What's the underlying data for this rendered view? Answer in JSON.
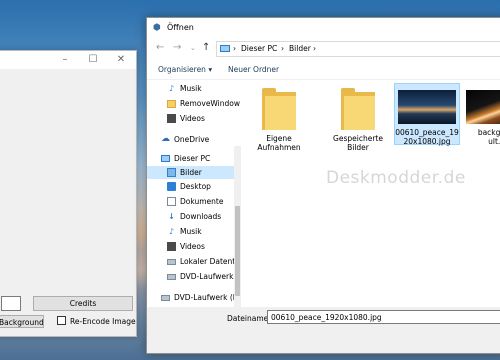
{
  "dialog": {
    "title": "Öffnen",
    "breadcrumb": [
      "Dieser PC",
      "Bilder"
    ],
    "toolbar": {
      "organize": "Organisieren ▾",
      "new_folder": "Neuer Ordner"
    },
    "nav_items": [
      {
        "label": "Musik",
        "icon": "music-icon"
      },
      {
        "label": "RemoveWindow",
        "icon": "folder-icon"
      },
      {
        "label": "Videos",
        "icon": "video-icon"
      },
      {
        "label": "OneDrive",
        "icon": "cloud-icon"
      },
      {
        "label": "Dieser PC",
        "icon": "pc-icon"
      },
      {
        "label": "Bilder",
        "icon": "pictures-icon"
      },
      {
        "label": "Desktop",
        "icon": "desktop-icon"
      },
      {
        "label": "Dokumente",
        "icon": "documents-icon"
      },
      {
        "label": "Downloads",
        "icon": "downloads-icon"
      },
      {
        "label": "Musik",
        "icon": "music-icon"
      },
      {
        "label": "Videos",
        "icon": "video-icon"
      },
      {
        "label": "Lokaler Datenträ",
        "icon": "drive-icon"
      },
      {
        "label": "DVD-Laufwerk (I",
        "icon": "dvd-icon"
      },
      {
        "label": "DVD-Laufwerk (D:",
        "icon": "dvd-icon"
      }
    ],
    "files": [
      {
        "name": "Eigene Aufnahmen",
        "type": "folder"
      },
      {
        "name": "Gespeicherte Bilder",
        "type": "folder"
      },
      {
        "name": "00610_peace_1920x1080.jpg",
        "type": "image"
      },
      {
        "name": "background ult.jpg",
        "type": "image"
      }
    ],
    "filename_label": "Dateiname:",
    "filename_value": "00610_peace_1920x1080.jpg",
    "watermark": "Deskmodder.de"
  },
  "app": {
    "credits_label": "Credits",
    "bg_button_label": "e Background",
    "reencode_label": "Re-Encode Image"
  }
}
